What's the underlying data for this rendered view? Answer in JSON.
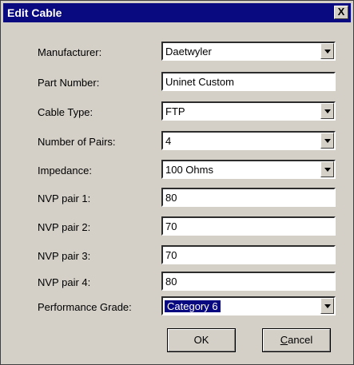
{
  "dialog": {
    "title": "Edit Cable",
    "close_label": "X"
  },
  "fields": {
    "manufacturer": {
      "label": "Manufacturer:",
      "value": "Daetwyler"
    },
    "part_number": {
      "label": "Part Number:",
      "value": "Uninet Custom"
    },
    "cable_type": {
      "label": "Cable Type:",
      "value": "FTP"
    },
    "number_of_pairs": {
      "label": "Number of Pairs:",
      "value": "4"
    },
    "impedance": {
      "label": "Impedance:",
      "value": "100 Ohms"
    },
    "nvp_pair_1": {
      "label": "NVP pair 1:",
      "value": "80"
    },
    "nvp_pair_2": {
      "label": "NVP pair 2:",
      "value": "70"
    },
    "nvp_pair_3": {
      "label": "NVP pair 3:",
      "value": "70"
    },
    "nvp_pair_4": {
      "label": "NVP pair 4:",
      "value": "80"
    },
    "performance_grade": {
      "label": "Performance Grade:",
      "value": "Category 6"
    }
  },
  "buttons": {
    "ok": "OK",
    "cancel_prefix": "C",
    "cancel_rest": "ancel"
  },
  "colors": {
    "titlebar": "#0a0a80",
    "dialog_bg": "#d4d0c8",
    "selection": "#0a0a80"
  }
}
